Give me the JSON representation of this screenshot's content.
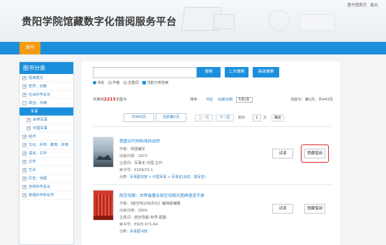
{
  "header": {
    "title": "贵阳学院馆藏数字化借阅服务平台",
    "top_links": [
      "图书馆首页",
      "退出"
    ]
  },
  "nav": {
    "active_item": "图书"
  },
  "sidebar": {
    "title": "图书分类",
    "items": [
      {
        "label": "经典理论",
        "toggle": "+"
      },
      {
        "label": "哲学、宗教",
        "toggle": "+"
      },
      {
        "label": "社会科学总论",
        "toggle": "+"
      },
      {
        "label": "政治、法律",
        "toggle": "-"
      },
      {
        "label": "军事",
        "toggle": ""
      },
      {
        "label": "世界军事",
        "toggle": "+"
      },
      {
        "label": "中国军事",
        "toggle": "+"
      },
      {
        "label": "经济",
        "toggle": "+"
      },
      {
        "label": "文化、科学、教育、体育",
        "toggle": "+"
      },
      {
        "label": "语言、文字",
        "toggle": "+"
      },
      {
        "label": "文学",
        "toggle": "+"
      },
      {
        "label": "艺术",
        "toggle": "+"
      },
      {
        "label": "历史、地理",
        "toggle": "+"
      },
      {
        "label": "自然科学总论",
        "toggle": "+"
      },
      {
        "label": "数理科学和化学",
        "toggle": "+"
      }
    ]
  },
  "search": {
    "placeholder": "",
    "search_btn": "搜索",
    "second_btn": "二次搜索",
    "advanced_btn": "高级搜索",
    "options": [
      "书名",
      "作者",
      "主题词"
    ],
    "selected_option": "书名",
    "current_cat_label": "当前分类检索",
    "current_cat_checked": true
  },
  "results": {
    "count_prefix": "共搜到",
    "count": "2213",
    "count_suffix": "本图书",
    "sort_label": "排序：",
    "sort_title": "书名",
    "sort_date": "出版日期",
    "per_page": "5本/页",
    "page_info": "当前为：第1页，共443页",
    "total_pages_btn": "共443页",
    "current_page_btn": "当前第1页",
    "prev": "上一页",
    "next": "下一页",
    "jump_label": "跳转",
    "page_value": "1",
    "page_unit": "页",
    "confirm": "确定"
  },
  "books": [
    {
      "title": "我国古代的陆海的战例",
      "author_label": "作者：",
      "author": "柯团编写",
      "date_label": "出版日期：",
      "date": "1973",
      "subject_label": "主题词：",
      "subject": "军事史 中国 古代",
      "callno_label": "索书号：",
      "callno": "K109/15.1",
      "cat_label": "分类：",
      "cat_path": [
        "军事图书馆",
        "中国军事",
        "军事史(战史、建军史)"
      ],
      "trial_btn": "试读",
      "borrow_btn": "馆藏借阅",
      "highlighted": true
    },
    {
      "title": "航空母舰：世界最著名航空母舰大图典速查手册",
      "author_label": "作者：",
      "author": "《航空知识杂志社》编辑部编著",
      "date_label": "出版日期：",
      "date": "2004",
      "subject_label": "主题词：",
      "subject": "航空母舰-世界-图集",
      "callno_label": "索书号：",
      "callno": "E925 671-64",
      "cat_label": "分类：",
      "cat_path": [
        "军事图书馆"
      ],
      "trial_btn": "试读",
      "borrow_btn": "馆藏借阅",
      "highlighted": false
    }
  ],
  "colors": {
    "brand_blue": "#1c8fdc",
    "nav_active": "#f39c12",
    "highlight_red": "#e0242b",
    "count_red": "#e02020"
  }
}
